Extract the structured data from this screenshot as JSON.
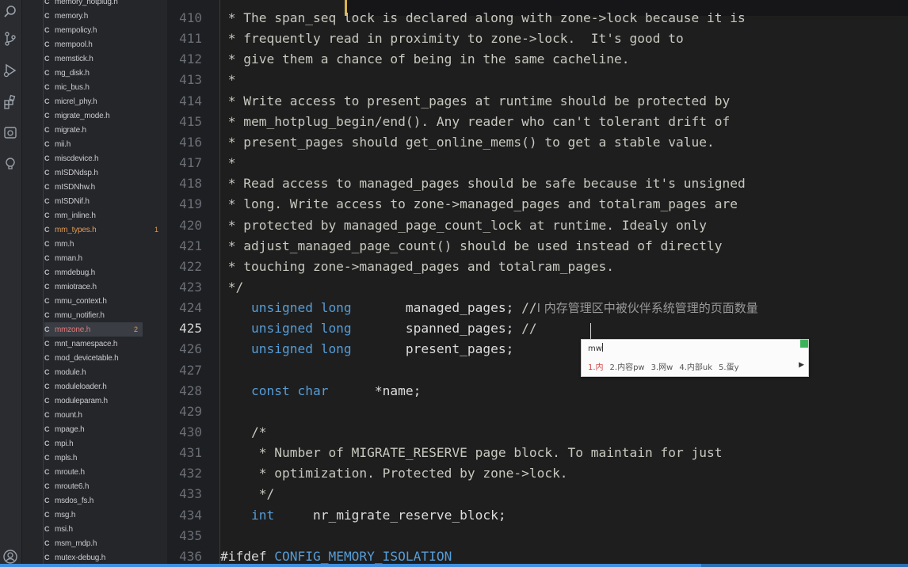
{
  "explorer": {
    "files": [
      {
        "name": "memory_hotplug.h",
        "icon": "C"
      },
      {
        "name": "memory.h",
        "icon": "C"
      },
      {
        "name": "mempolicy.h",
        "icon": "C"
      },
      {
        "name": "mempool.h",
        "icon": "C"
      },
      {
        "name": "memstick.h",
        "icon": "C"
      },
      {
        "name": "mg_disk.h",
        "icon": "C"
      },
      {
        "name": "mic_bus.h",
        "icon": "C"
      },
      {
        "name": "micrel_phy.h",
        "icon": "C"
      },
      {
        "name": "migrate_mode.h",
        "icon": "C"
      },
      {
        "name": "migrate.h",
        "icon": "C"
      },
      {
        "name": "mii.h",
        "icon": "C"
      },
      {
        "name": "miscdevice.h",
        "icon": "C"
      },
      {
        "name": "mISDNdsp.h",
        "icon": "C"
      },
      {
        "name": "mISDNhw.h",
        "icon": "C"
      },
      {
        "name": "mISDNif.h",
        "icon": "C"
      },
      {
        "name": "mm_inline.h",
        "icon": "C"
      },
      {
        "name": "mm_types.h",
        "icon": "C",
        "badge": "1"
      },
      {
        "name": "mm.h",
        "icon": "C"
      },
      {
        "name": "mman.h",
        "icon": "C"
      },
      {
        "name": "mmdebug.h",
        "icon": "C"
      },
      {
        "name": "mmiotrace.h",
        "icon": "C"
      },
      {
        "name": "mmu_context.h",
        "icon": "C"
      },
      {
        "name": "mmu_notifier.h",
        "icon": "C"
      },
      {
        "name": "mmzone.h",
        "icon": "C",
        "badge": "2"
      },
      {
        "name": "mnt_namespace.h",
        "icon": "C"
      },
      {
        "name": "mod_devicetable.h",
        "icon": "C"
      },
      {
        "name": "module.h",
        "icon": "C"
      },
      {
        "name": "moduleloader.h",
        "icon": "C"
      },
      {
        "name": "moduleparam.h",
        "icon": "C"
      },
      {
        "name": "mount.h",
        "icon": "C"
      },
      {
        "name": "mpage.h",
        "icon": "C"
      },
      {
        "name": "mpi.h",
        "icon": "C"
      },
      {
        "name": "mpls.h",
        "icon": "C"
      },
      {
        "name": "mroute.h",
        "icon": "C"
      },
      {
        "name": "mroute6.h",
        "icon": "C"
      },
      {
        "name": "msdos_fs.h",
        "icon": "C"
      },
      {
        "name": "msg.h",
        "icon": "C"
      },
      {
        "name": "msi.h",
        "icon": "C"
      },
      {
        "name": "msm_mdp.h",
        "icon": "C"
      },
      {
        "name": "mutex-debug.h",
        "icon": "C"
      }
    ]
  },
  "editor": {
    "line_numbers": [
      "410",
      "411",
      "412",
      "413",
      "414",
      "415",
      "416",
      "417",
      "418",
      "419",
      "420",
      "421",
      "422",
      "423",
      "424",
      "425",
      "426",
      "427",
      "428",
      "429",
      "430",
      "431",
      "432",
      "433",
      "434",
      "435",
      "436"
    ],
    "current_line": "425",
    "lines": [
      {
        "c": " * The span_seq lock is declared along with zone->lock because it is"
      },
      {
        "c": " * frequently read in proximity to zone->lock.  It's good to"
      },
      {
        "c": " * give them a chance of being in the same cacheline."
      },
      {
        "c": " *"
      },
      {
        "c": " * Write access to present_pages at runtime should be protected by"
      },
      {
        "c": " * mem_hotplug_begin/end(). Any reader who can't tolerant drift of"
      },
      {
        "c": " * present_pages should get_online_mems() to get a stable value."
      },
      {
        "c": " *"
      },
      {
        "c": " * Read access to managed_pages should be safe because it's unsigned"
      },
      {
        "c": " * long. Write access to zone->managed_pages and totalram_pages are"
      },
      {
        "c": " * protected by managed_page_count_lock at runtime. Idealy only"
      },
      {
        "c": " * adjust_managed_page_count() should be used instead of directly"
      },
      {
        "c": " * touching zone->managed_pages and totalram_pages."
      },
      {
        "c": " */"
      },
      {
        "k": "\tunsigned long",
        "i": "\t\tmanaged_pages;",
        "c": " //",
        "z": "I 内存管理区中被伙伴系统管理的页面数量"
      },
      {
        "k": "\tunsigned long",
        "i": "\t\tspanned_pages;",
        "c": " //"
      },
      {
        "k": "\tunsigned long",
        "i": "\t\tpresent_pages;"
      },
      {
        "c": ""
      },
      {
        "k": "\tconst char",
        "i": "\t\t*name;"
      },
      {
        "c": ""
      },
      {
        "c": "\t/*"
      },
      {
        "c": "\t * Number of MIGRATE_RESERVE page block. To maintain for just"
      },
      {
        "c": "\t * optimization. Protected by zone->lock."
      },
      {
        "c": "\t */"
      },
      {
        "k": "\tint",
        "i": "\t\tnr_migrate_reserve_block;"
      },
      {
        "c": ""
      },
      {
        "p": "#ifdef",
        "m": " CONFIG_MEMORY_ISOLATION"
      }
    ]
  },
  "ime": {
    "input": "mw",
    "candidates": [
      "1.内",
      "2.内容pw",
      "3.网w",
      "4.内部uk",
      "5.蛋y"
    ],
    "next_glyph": "▶"
  },
  "colors": {
    "accent": "#d9b44a",
    "keyword": "#569cd6",
    "status": "#3f8fe0"
  }
}
